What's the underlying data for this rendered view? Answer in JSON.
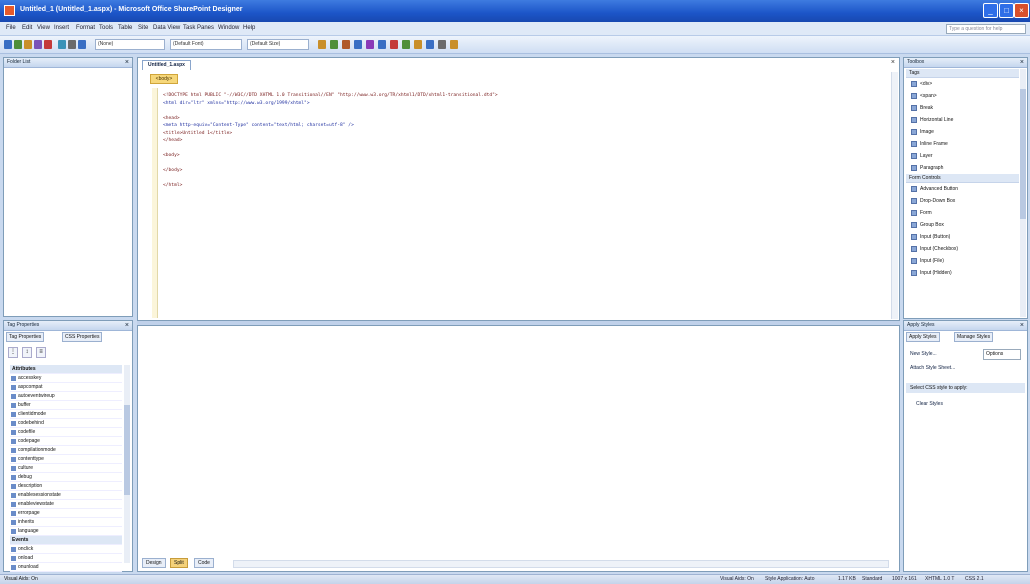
{
  "window": {
    "title": "Untitled_1 (Untitled_1.aspx) - Microsoft Office SharePoint Designer"
  },
  "menu": [
    "File",
    "Edit",
    "View",
    "Insert",
    "Format",
    "Tools",
    "Table",
    "Site",
    "Data View",
    "Task Panes",
    "Window",
    "Help"
  ],
  "help_placeholder": "Type a question for help",
  "toolbar": {
    "style_select": "(None)",
    "font_select": "(Default Font)",
    "size_select": "(Default Size)",
    "icon_colors": [
      "#3a6fc4",
      "#4f8f3a",
      "#c98f2a",
      "#7a52b8",
      "#c43a3a",
      "#3a93b8",
      "#6b6b6b",
      "#3a6fc4",
      "#c98f2a",
      "#4f8f3a",
      "#b05a2a",
      "#3a6fc4",
      "#8a3ab8",
      "#3a6fc4",
      "#c43a3a",
      "#4f8f3a",
      "#c98f2a",
      "#3a6fc4",
      "#6b6b6b",
      "#c98f2a"
    ]
  },
  "folder_list": {
    "title": "Folder List"
  },
  "tag_properties": {
    "title": "Tag Properties",
    "tabs": [
      "Tag Properties",
      "CSS Properties"
    ],
    "rows": [
      {
        "label": "Attributes",
        "group": true
      },
      {
        "label": "accesskey",
        "group": false
      },
      {
        "label": "aspcompat",
        "group": false
      },
      {
        "label": "autoeventwireup",
        "group": false
      },
      {
        "label": "buffer",
        "group": false
      },
      {
        "label": "clientidmode",
        "group": false
      },
      {
        "label": "codebehind",
        "group": false
      },
      {
        "label": "codefile",
        "group": false
      },
      {
        "label": "codepage",
        "group": false
      },
      {
        "label": "compilationmode",
        "group": false
      },
      {
        "label": "contenttype",
        "group": false
      },
      {
        "label": "culture",
        "group": false
      },
      {
        "label": "debug",
        "group": false
      },
      {
        "label": "description",
        "group": false
      },
      {
        "label": "enablesessionstate",
        "group": false
      },
      {
        "label": "enableviewstate",
        "group": false
      },
      {
        "label": "errorpage",
        "group": false
      },
      {
        "label": "inherits",
        "group": false
      },
      {
        "label": "language",
        "group": false
      },
      {
        "label": "Events",
        "group": true
      },
      {
        "label": "onclick",
        "group": false
      },
      {
        "label": "onload",
        "group": false
      },
      {
        "label": "onunload",
        "group": false
      }
    ]
  },
  "editor": {
    "tab": "Untitled_1.aspx",
    "tag": "<body>",
    "lines": [
      {
        "text": "<!DOCTYPE html PUBLIC \"-//W3C//DTD XHTML 1.0 Transitional//EN\" \"http://www.w3.org/TR/xhtml1/DTD/xhtml1-transitional.dtd\">",
        "blue": false
      },
      {
        "text": "<html dir=\"ltr\" xmlns=\"http://www.w3.org/1999/xhtml\">",
        "blue": true
      },
      {
        "text": "",
        "blue": false
      },
      {
        "text": "<head>",
        "blue": false
      },
      {
        "text": "<meta http-equiv=\"Content-Type\" content=\"text/html; charset=utf-8\" />",
        "blue": true
      },
      {
        "text": "<title>Untitled 1</title>",
        "blue": false
      },
      {
        "text": "</head>",
        "blue": false
      },
      {
        "text": "",
        "blue": false
      },
      {
        "text": "<body>",
        "blue": false
      },
      {
        "text": "",
        "blue": false
      },
      {
        "text": "</body>",
        "blue": false
      },
      {
        "text": "",
        "blue": false
      },
      {
        "text": "</html>",
        "blue": false
      }
    ]
  },
  "view_tabs": [
    "Design",
    "Split",
    "Code"
  ],
  "toolbox": {
    "title": "Toolbox",
    "sections": [
      {
        "title": "Tags",
        "items": [
          "<div>",
          "<span>",
          "Break",
          "Horizontal Line",
          "Image",
          "Inline Frame",
          "Layer",
          "Paragraph"
        ]
      },
      {
        "title": "Form Controls",
        "items": [
          "Advanced Button",
          "Drop-Down Box",
          "Form",
          "Group Box",
          "Input (Button)",
          "Input (Checkbox)",
          "Input (File)",
          "Input (Hidden)"
        ]
      }
    ]
  },
  "apply_styles": {
    "title": "Apply Styles",
    "tabs": [
      "Apply Styles",
      "Manage Styles"
    ],
    "new_style": "New Style...",
    "options": "Options",
    "attach": "Attach Style Sheet...",
    "select_label": "Select CSS style to apply:",
    "clear_styles": "Clear Styles"
  },
  "status": {
    "left": "Visual Aids: On",
    "segments": [
      "Visual Aids: On",
      "Style Application: Auto",
      "1.17 KB",
      "Standard",
      "1007 x 161",
      "XHTML 1.0 T",
      "CSS 2.1"
    ]
  }
}
